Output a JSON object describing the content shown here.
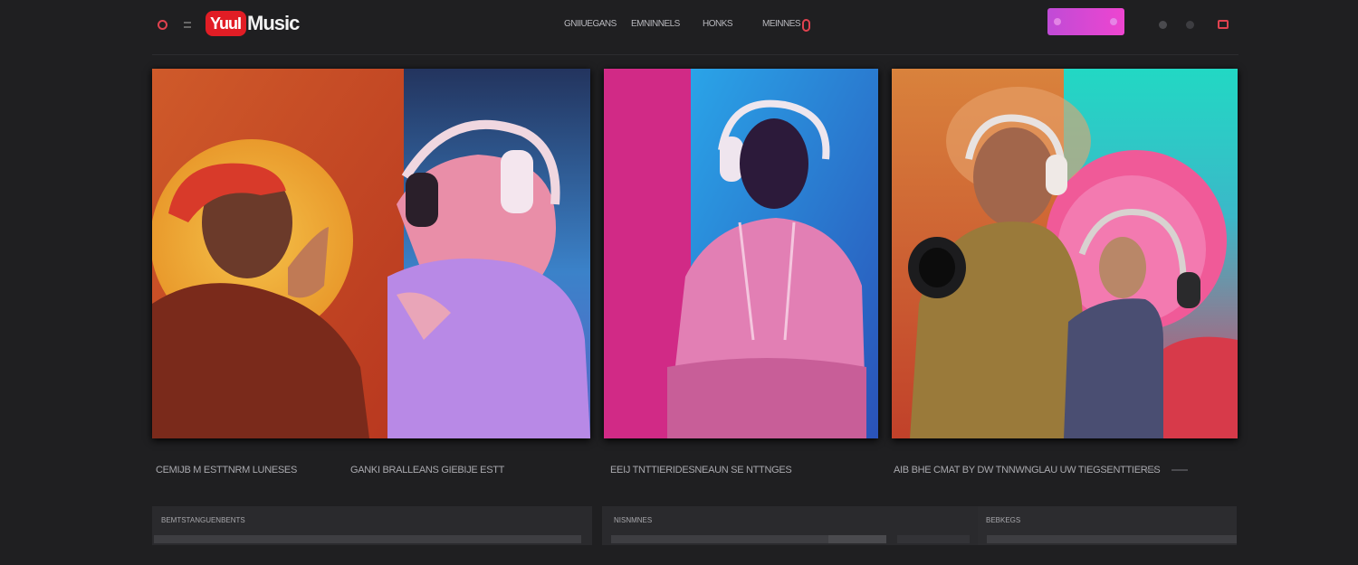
{
  "header": {
    "logo_badge": "YuuI",
    "logo_text": "Music",
    "nav": [
      "GNIIUEGANS",
      "EMNINNELS",
      "HONKS",
      "MEINNES"
    ],
    "cta_label": ""
  },
  "cards": [
    {
      "name": "card-artists-orange"
    },
    {
      "name": "card-pink-hoodie"
    },
    {
      "name": "card-headphones-duo"
    }
  ],
  "captions": [
    "CEMIJB M ESTTNRM LUNESES",
    "GANKI BRALLEANS GIEBIJE ESTT",
    "EEIJ TNTTIERIDESNEAUN SE NTTNGES",
    "AIB BHE CMAT BY DW TNNWNGLAU UW TIEGSENTTIERES"
  ],
  "panels": [
    {
      "label": "BEMTSTANGUENBENTS"
    },
    {
      "label": "NISNMNES"
    },
    {
      "label": "BEBKEGS"
    }
  ]
}
